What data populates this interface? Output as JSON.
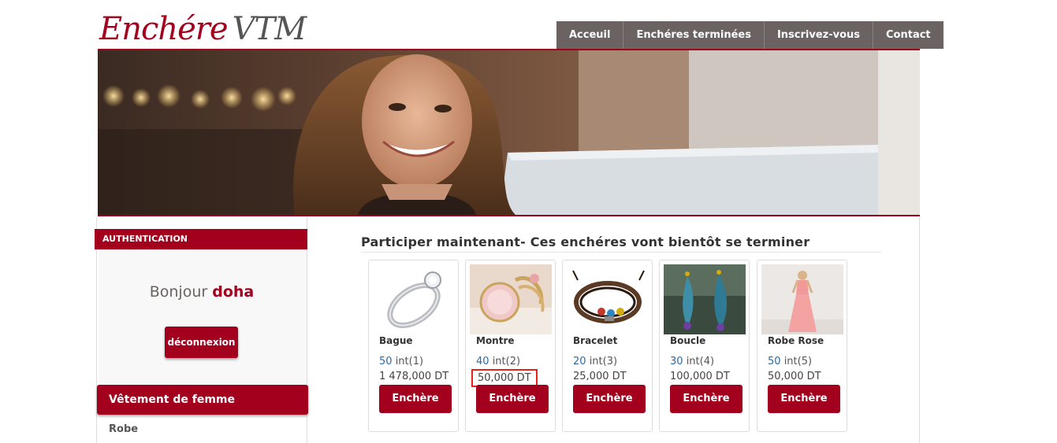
{
  "brand": {
    "logo_main": "Enchére",
    "logo_secondary": "VTM"
  },
  "nav": [
    {
      "label": "Acceuil"
    },
    {
      "label": "Enchéres terminées"
    },
    {
      "label": "Inscrivez-vous"
    },
    {
      "label": "Contact"
    }
  ],
  "sidebar": {
    "auth_title": "AUTHENTICATION",
    "greeting": "Bonjour",
    "username": "doha",
    "logout_label": "déconnexion",
    "category_title": "Vêtement de femme",
    "category_items": [
      "Robe"
    ]
  },
  "main": {
    "section_title": "Participer maintenant- Ces enchéres vont bientôt se terminer",
    "cards": [
      {
        "name": "Bague",
        "bid_value": "50",
        "bid_label": "int(1)",
        "price": "1 478,000 DT",
        "button": "Enchère"
      },
      {
        "name": "Montre",
        "bid_value": "40",
        "bid_label": "int(2)",
        "price": "50,000 DT",
        "button": "Enchère"
      },
      {
        "name": "Bracelet",
        "bid_value": "20",
        "bid_label": "int(3)",
        "price": "25,000 DT",
        "button": "Enchère"
      },
      {
        "name": "Boucle",
        "bid_value": "30",
        "bid_label": "int(4)",
        "price": "100,000 DT",
        "button": "Enchère"
      },
      {
        "name": "Robe Rose",
        "bid_value": "50",
        "bid_label": "int(5)",
        "price": "50,000 DT",
        "button": "Enchère"
      }
    ]
  },
  "colors": {
    "accent": "#a3001e",
    "nav_bg": "#6b6262",
    "link": "#2a6aa8",
    "highlight": "#e8201e"
  }
}
